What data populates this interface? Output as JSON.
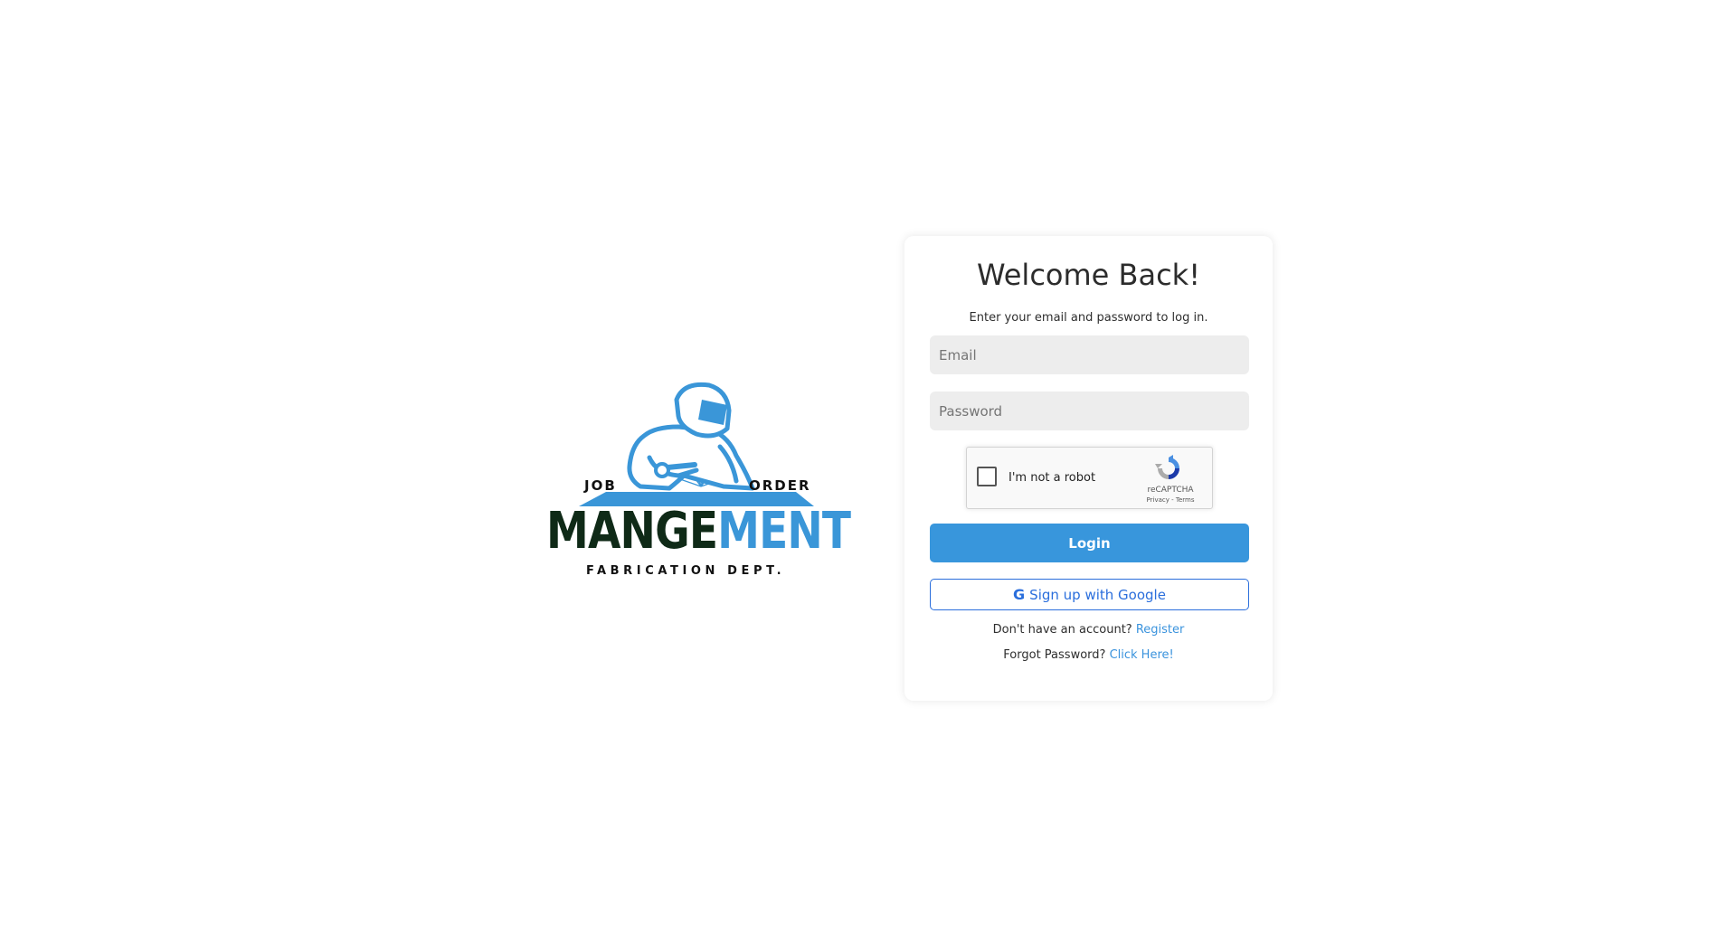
{
  "logo": {
    "word_left": "JOB",
    "word_right": "ORDER",
    "title_dark": "MANGE",
    "title_blue": "MENT",
    "subtitle": "FABRICATION DEPT.",
    "colors": {
      "dark": "#0f2a17",
      "blue": "#3a96d8"
    }
  },
  "login": {
    "title": "Welcome Back!",
    "subtitle": "Enter your email and password to log in.",
    "email_placeholder": "Email",
    "email_value": "",
    "password_placeholder": "Password",
    "password_value": "",
    "recaptcha": {
      "label": "I'm not a robot",
      "brand": "reCAPTCHA",
      "links": "Privacy - Terms",
      "checked": false
    },
    "login_button": "Login",
    "google_icon": "G",
    "google_button": "Sign up with Google",
    "register_prompt": "Don't have an account?",
    "register_link": "Register",
    "forgot_prompt": "Forgot Password?",
    "forgot_link": "Click Here!"
  },
  "colors": {
    "primary": "#3896dc",
    "google_blue": "#2a6edc",
    "link": "#3a93dd",
    "input_bg": "#ededed"
  }
}
